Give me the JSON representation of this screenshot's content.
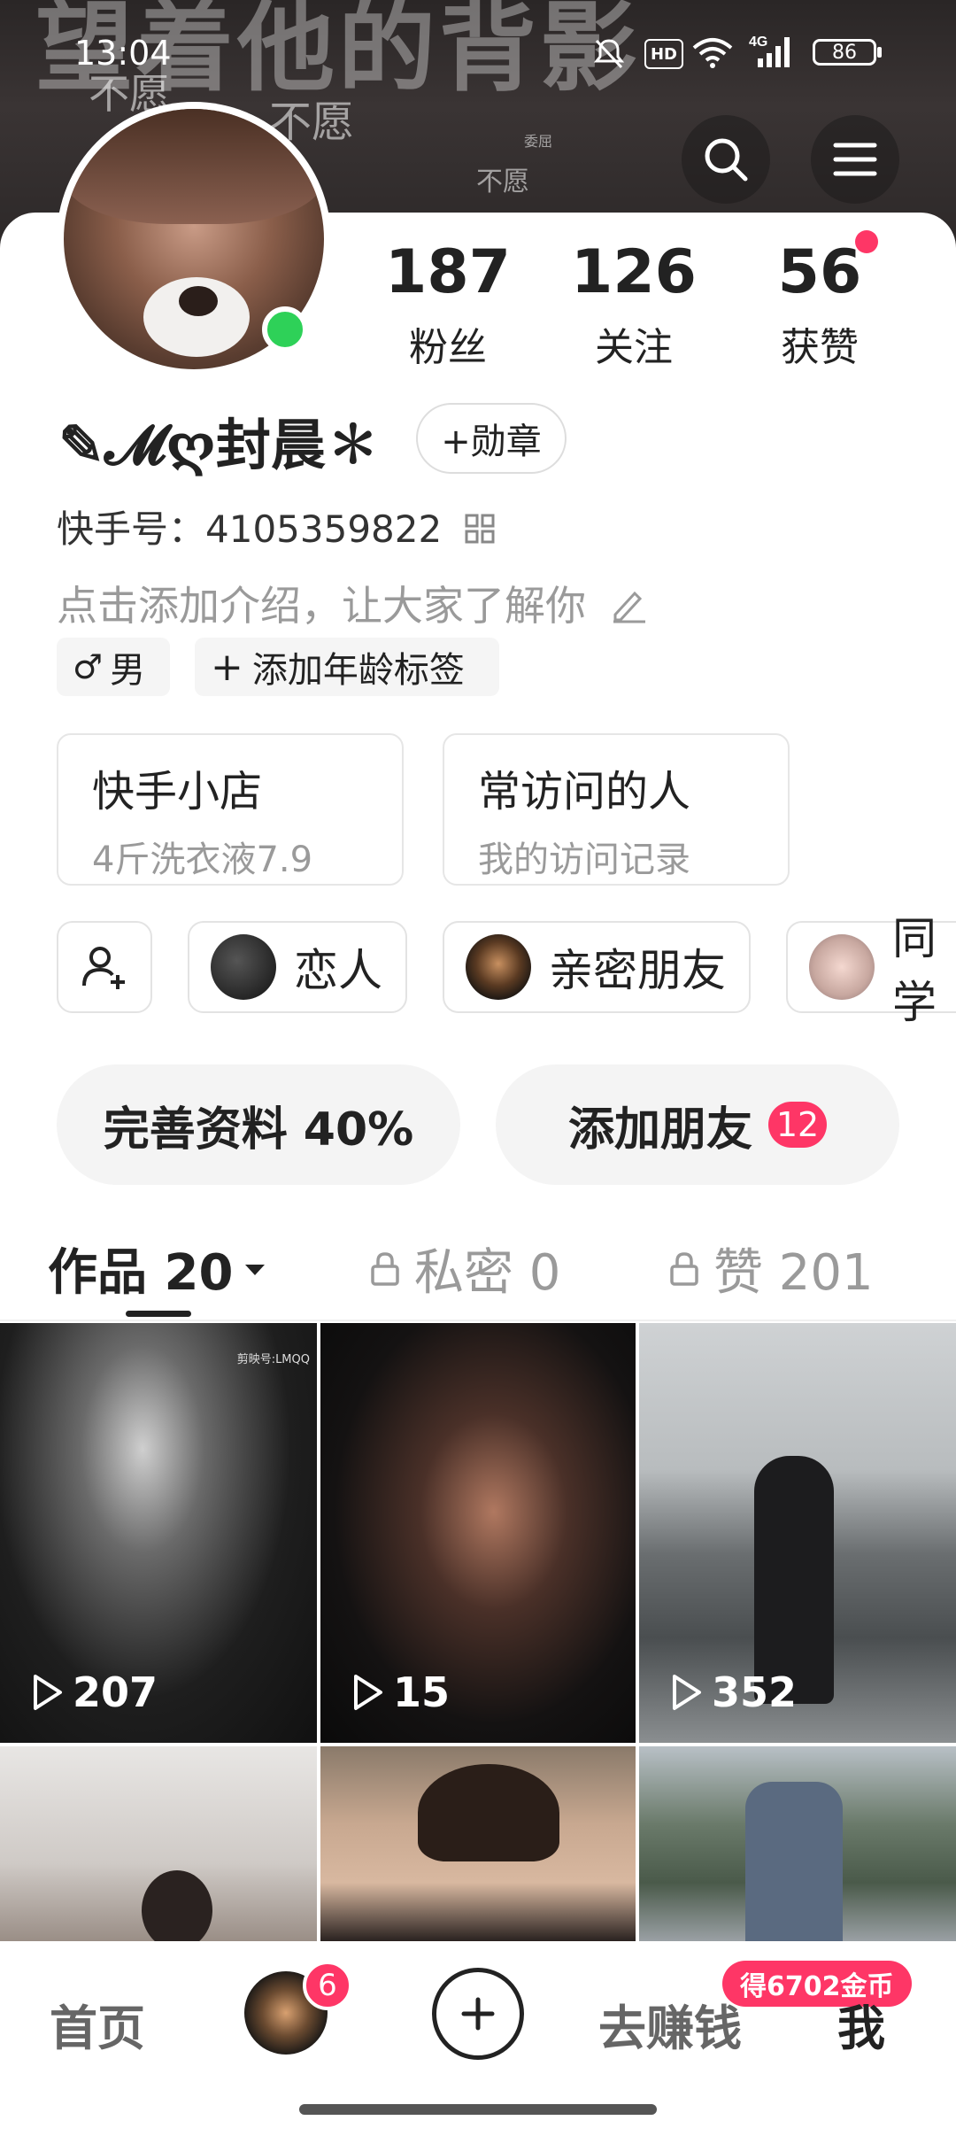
{
  "status_bar": {
    "time": "13:04",
    "hd": "HD",
    "network": "4G",
    "battery": "86"
  },
  "header": {
    "background_text": {
      "title_fragment": "望着他的背影",
      "words": [
        "不愿",
        "不愿",
        "不愿",
        "委屈"
      ]
    },
    "search_icon": "search-icon",
    "menu_icon": "menu-icon"
  },
  "profile": {
    "stats": [
      {
        "value": "187",
        "label": "粉丝"
      },
      {
        "value": "126",
        "label": "关注"
      },
      {
        "value": "56",
        "label": "获赞"
      }
    ],
    "username": "✎𝓜ღ封晨✽",
    "badge_button": "+勋章",
    "kuaishou_id": "快手号：4105359822",
    "intro_placeholder": "点击添加介绍，让大家了解你",
    "tags": {
      "gender": "男",
      "age": "添加年龄标签"
    }
  },
  "info_cards": [
    {
      "title": "快手小店",
      "subtitle": "4斤洗衣液7.9"
    },
    {
      "title": "常访问的人",
      "subtitle": "我的访问记录"
    }
  ],
  "relation_chips": [
    {
      "label": "恋人"
    },
    {
      "label": "亲密朋友"
    },
    {
      "label": "同学"
    }
  ],
  "actions": {
    "complete_profile": "完善资料 40%",
    "add_friends": "添加朋友",
    "add_friends_count": "12"
  },
  "tabs": [
    {
      "label": "作品 20",
      "active": true
    },
    {
      "label": "私密 0",
      "locked": true
    },
    {
      "label": "赞 201",
      "locked": true
    }
  ],
  "videos": [
    {
      "plays": "207",
      "watermark": "剪映号:LMQQ"
    },
    {
      "plays": "15"
    },
    {
      "plays": "352"
    },
    {
      "plays": ""
    },
    {
      "plays": ""
    },
    {
      "plays": ""
    }
  ],
  "bottom_nav": {
    "home": "首页",
    "messages_badge": "6",
    "earn": "去赚钱",
    "coin_badge": "得6702金币",
    "me": "我"
  },
  "colors": {
    "accent": "#fe3666",
    "online": "#2ed158",
    "text": "#222222",
    "muted": "#9a9a9a"
  }
}
